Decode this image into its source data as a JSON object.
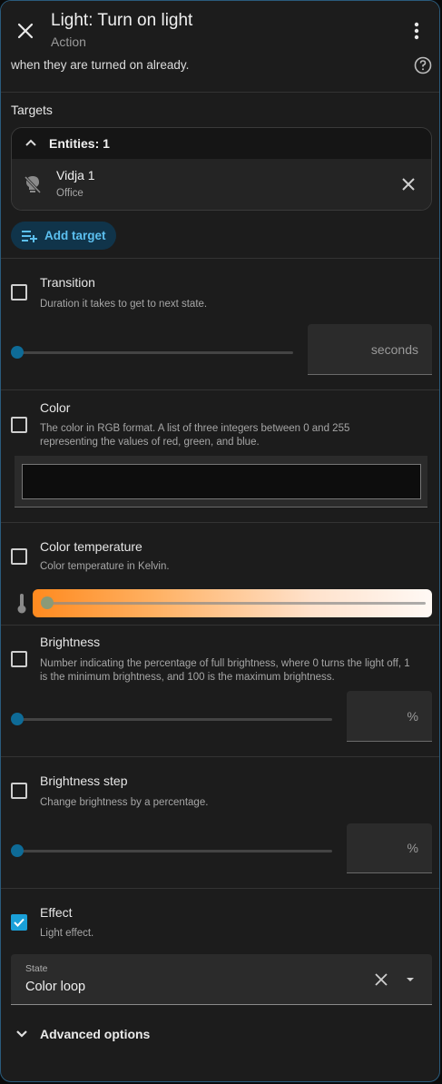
{
  "header": {
    "title": "Light: Turn on light",
    "subtitle": "Action"
  },
  "description_tail": "when they are turned on already.",
  "targets": {
    "label": "Targets",
    "entities_header": "Entities: 1",
    "entity": {
      "name": "Vidja 1",
      "area": "Office"
    },
    "add_target_label": "Add target"
  },
  "fields": {
    "transition": {
      "label": "Transition",
      "hint": "Duration it takes to get to next state.",
      "unit": "seconds",
      "checked": false
    },
    "color": {
      "label": "Color",
      "hint": "The color in RGB format. A list of three integers between 0 and 255 representing the values of red, green, and blue.",
      "checked": false
    },
    "color_temperature": {
      "label": "Color temperature",
      "hint": "Color temperature in Kelvin.",
      "checked": false
    },
    "brightness": {
      "label": "Brightness",
      "hint": "Number indicating the percentage of full brightness, where 0 turns the light off, 1 is the minimum brightness, and 100 is the maximum brightness.",
      "unit": "%",
      "checked": false
    },
    "brightness_step": {
      "label": "Brightness step",
      "hint": "Change brightness by a percentage.",
      "unit": "%",
      "checked": false
    },
    "effect": {
      "label": "Effect",
      "hint": "Light effect.",
      "checked": true,
      "state_label": "State",
      "state_value": "Color loop"
    }
  },
  "advanced_label": "Advanced options",
  "colors": {
    "accent": "#1aa0d8",
    "background": "#1c1c1c",
    "border": "#2a5b7c"
  },
  "icons": [
    "close-icon",
    "more-vert-icon",
    "help-circle-icon",
    "chevron-up-icon",
    "lightbulb-off-icon",
    "add-list-icon",
    "thermometer-icon",
    "check-icon",
    "menu-down-icon",
    "chevron-down-icon"
  ]
}
